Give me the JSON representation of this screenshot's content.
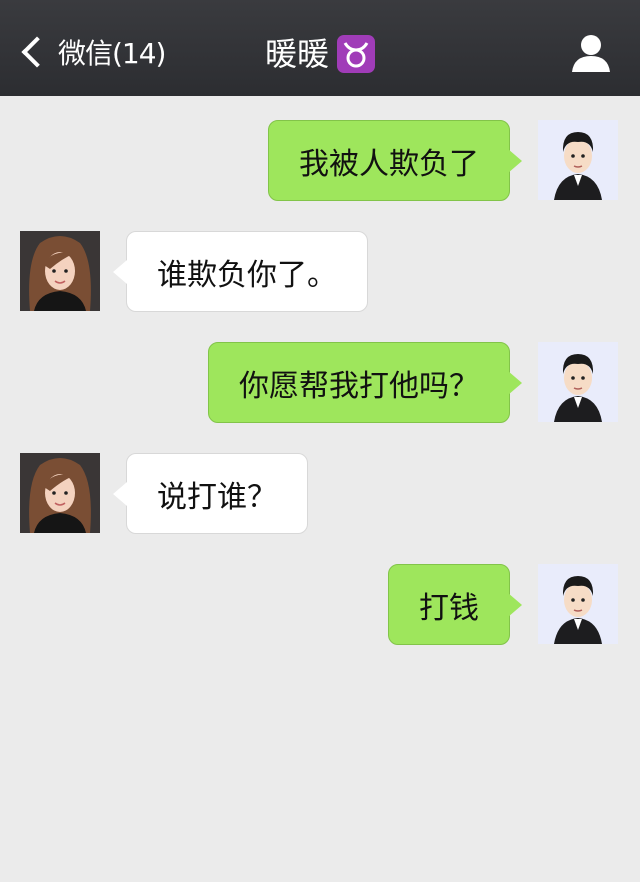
{
  "header": {
    "back_label": "微信(14)",
    "title": "暖暖",
    "title_icon": "taurus-zodiac-icon",
    "profile_icon": "person-icon"
  },
  "colors": {
    "header_bg": "#2f3034",
    "chat_bg": "#ebebeb",
    "outgoing_bubble": "#9ee65c",
    "incoming_bubble": "#ffffff",
    "zodiac_badge": "#a03cb8"
  },
  "messages": [
    {
      "direction": "outgoing",
      "sender": "me",
      "text": "我被人欺负了"
    },
    {
      "direction": "incoming",
      "sender": "暖暖",
      "text": "谁欺负你了。"
    },
    {
      "direction": "outgoing",
      "sender": "me",
      "text": "你愿帮我打他吗？"
    },
    {
      "direction": "incoming",
      "sender": "暖暖",
      "text": "说打谁？"
    },
    {
      "direction": "outgoing",
      "sender": "me",
      "text": "打钱"
    }
  ]
}
